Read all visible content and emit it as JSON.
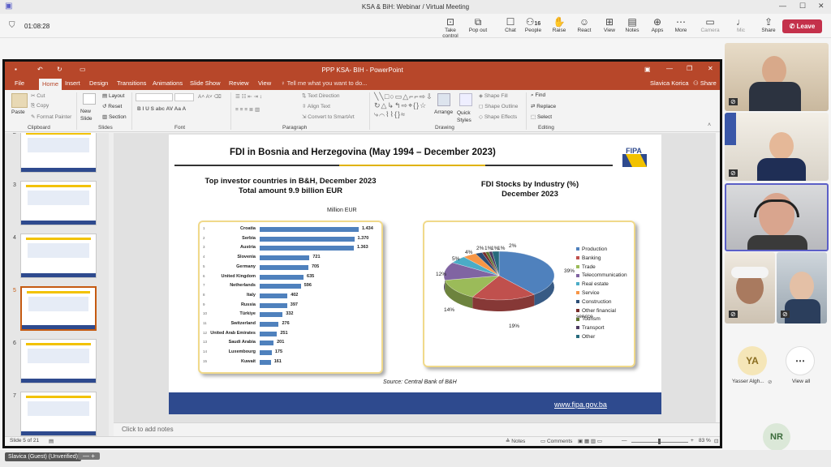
{
  "teams": {
    "window_title": "KSA & BiH: Webinar / Virtual Meeting",
    "timer": "01:08:28",
    "tools": [
      {
        "label": "Take control",
        "icon": "take-control-icon"
      },
      {
        "label": "Pop out",
        "icon": "pop-out-icon"
      },
      {
        "label": "Chat",
        "icon": "chat-icon"
      },
      {
        "label": "People",
        "icon": "people-icon",
        "count": "16"
      },
      {
        "label": "Raise",
        "icon": "raise-hand-icon"
      },
      {
        "label": "React",
        "icon": "react-icon"
      },
      {
        "label": "View",
        "icon": "view-icon"
      },
      {
        "label": "Notes",
        "icon": "notes-icon"
      },
      {
        "label": "Apps",
        "icon": "apps-icon"
      },
      {
        "label": "More",
        "icon": "more-icon"
      },
      {
        "label": "Camera",
        "icon": "camera-icon"
      },
      {
        "label": "Mic",
        "icon": "mic-icon"
      },
      {
        "label": "Share",
        "icon": "share-icon"
      }
    ],
    "leave": "Leave"
  },
  "ppt": {
    "title": "PPP KSA- BIH - PowerPoint",
    "user": "Slavica Korica",
    "share": "Share",
    "tabs": [
      "File",
      "Home",
      "Insert",
      "Design",
      "Transitions",
      "Animations",
      "Slide Show",
      "Review",
      "View"
    ],
    "tell_me": "Tell me what you want to do...",
    "ribbon": {
      "paste": "Paste",
      "cut": "Cut",
      "copy": "Copy",
      "format_painter": "Format Painter",
      "clipboard": "Clipboard",
      "new_slide": "New Slide",
      "layout": "Layout",
      "reset": "Reset",
      "section": "Section",
      "slides": "Slides",
      "font": "Font",
      "paragraph": "Paragraph",
      "text_direction": "Text Direction",
      "align_text": "Align Text",
      "convert_smartart": "Convert to SmartArt",
      "arrange": "Arrange",
      "quick_styles": "Quick Styles",
      "shape_fill": "Shape Fill",
      "shape_outline": "Shape Outline",
      "shape_effects": "Shape Effects",
      "drawing": "Drawing",
      "find": "Find",
      "replace": "Replace",
      "select": "Select",
      "editing": "Editing"
    },
    "thumbs": [
      "2",
      "3",
      "4",
      "5",
      "6",
      "7"
    ],
    "notes_placeholder": "Click to add notes",
    "status": {
      "slide": "Slide 5 of 21",
      "notes": "Notes",
      "comments": "Comments",
      "zoom": "83 %"
    }
  },
  "slide": {
    "title": "FDI in Bosnia and Herzegovina (May 1994 – December 2023)",
    "logo": "FIPA",
    "left_heading": "Top investor countries in B&H, December 2023",
    "left_sub": "Total amount 9.9 billion EUR",
    "unit": "Million EUR",
    "right_heading": "FDI Stocks by Industry (%)",
    "right_sub": "December 2023",
    "source": "Source: Central Bank of B&H",
    "url": "www.fipa.gov.ba"
  },
  "chart_data": [
    {
      "type": "bar",
      "title": "Top investor countries in B&H, December 2023",
      "ylabel": "Million EUR",
      "categories": [
        "Croatia",
        "Serbia",
        "Austria",
        "Slovenia",
        "Germany",
        "United Kingdom",
        "Netherlands",
        "Italy",
        "Russia",
        "Türkiye",
        "Switzerland",
        "United Arab Emirates",
        "Saudi Arabia",
        "Luxembourg",
        "Kuwait"
      ],
      "values": [
        1434,
        1370,
        1363,
        721,
        705,
        635,
        596,
        402,
        397,
        332,
        276,
        251,
        201,
        175,
        161
      ],
      "value_labels": [
        "1.434",
        "1.370",
        "1.363",
        "721",
        "705",
        "635",
        "596",
        "402",
        "397",
        "332",
        "276",
        "251",
        "201",
        "175",
        "161"
      ],
      "ranks": [
        "1",
        "2",
        "3",
        "4",
        "5",
        "6",
        "7",
        "8",
        "9",
        "10",
        "11",
        "12",
        "13",
        "14",
        "15"
      ]
    },
    {
      "type": "pie",
      "title": "FDI Stocks by Industry (%)",
      "categories": [
        "Production",
        "Banking",
        "Trade",
        "Telecommunication",
        "Real estate",
        "Service",
        "Construction",
        "Other financial service",
        "Tourism",
        "Transport",
        "Other"
      ],
      "values": [
        39,
        19,
        14,
        12,
        5,
        4,
        2,
        1,
        1,
        1,
        2
      ],
      "labels": [
        "39%",
        "19%",
        "14%",
        "12%",
        "5%",
        "4%",
        "2%",
        "1%",
        "1%",
        "1%",
        "2%"
      ],
      "colors": [
        "#4f81bd",
        "#c0504d",
        "#9bbb59",
        "#8064a2",
        "#4bacc6",
        "#f79646",
        "#2c4d75",
        "#772c2a",
        "#5f7530",
        "#4d3b62",
        "#276a7c"
      ]
    }
  ],
  "participants": {
    "yasser_initials": "YA",
    "yasser_name": "Yasser Algh...",
    "view_all": "View all",
    "nr": "NR",
    "bottom_name": "Slavica (Guest) (Unverified)"
  }
}
